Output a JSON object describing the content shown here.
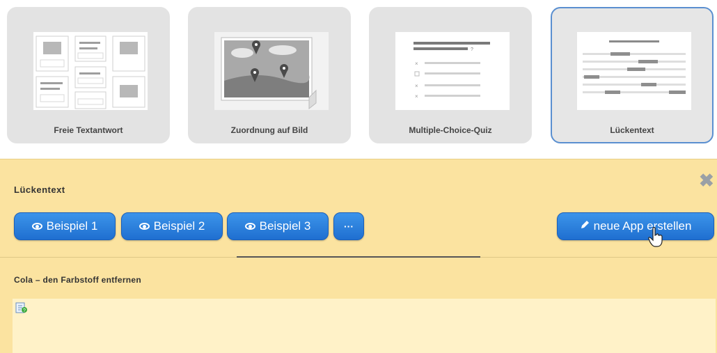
{
  "templates": [
    {
      "label": "Freie Textantwort",
      "icon": "free-text-template-icon",
      "selected": false
    },
    {
      "label": "Zuordnung auf Bild",
      "icon": "image-map-template-icon",
      "selected": false
    },
    {
      "label": "Multiple-Choice-Quiz",
      "icon": "multiple-choice-template-icon",
      "selected": false
    },
    {
      "label": "Lückentext",
      "icon": "cloze-text-template-icon",
      "selected": true
    }
  ],
  "panel": {
    "title": "Lückentext",
    "examples": [
      {
        "label": "Beispiel 1"
      },
      {
        "label": "Beispiel 2"
      },
      {
        "label": "Beispiel 3"
      }
    ],
    "more_label": "···",
    "create_label": "neue App erstellen",
    "subtitle": "Cola – den Farbstoff entfernen"
  },
  "colors": {
    "accent": "#2a7de1",
    "panel_bg": "#fbe3a0",
    "card_bg": "#e3e3e3",
    "selected_border": "#5a8fd0"
  }
}
